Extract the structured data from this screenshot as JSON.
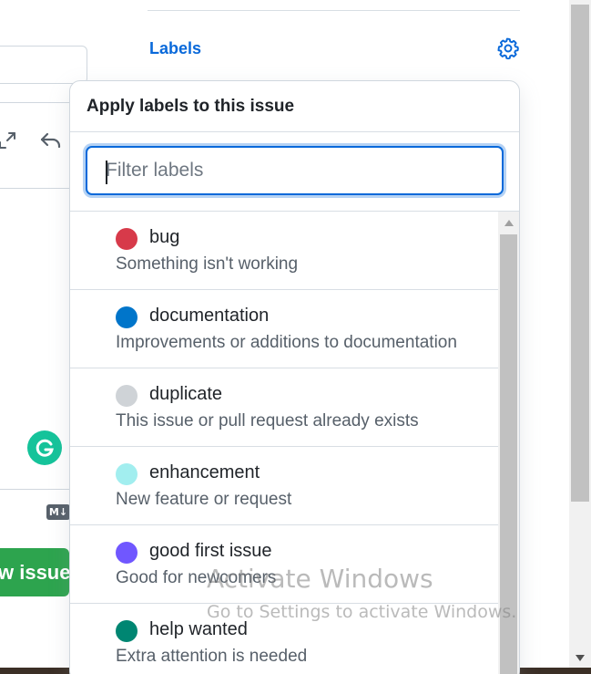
{
  "sidebar": {
    "labels_heading": "Labels"
  },
  "background": {
    "submit_button_label": "w issue",
    "markdown_badge": "M↓"
  },
  "popover": {
    "title": "Apply labels to this issue",
    "filter": {
      "placeholder": "Filter labels",
      "value": ""
    },
    "labels": [
      {
        "name": "bug",
        "description": "Something isn't working",
        "color": "#d73a4a"
      },
      {
        "name": "documentation",
        "description": "Improvements or additions to documentation",
        "color": "#0075ca"
      },
      {
        "name": "duplicate",
        "description": "This issue or pull request already exists",
        "color": "#cfd3d7"
      },
      {
        "name": "enhancement",
        "description": "New feature or request",
        "color": "#a2eeef"
      },
      {
        "name": "good first issue",
        "description": "Good for newcomers",
        "color": "#7057ff"
      },
      {
        "name": "help wanted",
        "description": "Extra attention is needed",
        "color": "#008672"
      }
    ]
  },
  "watermark": {
    "title": "Activate Windows",
    "subtitle": "Go to Settings to activate Windows."
  },
  "colors": {
    "accent": "#0969da",
    "submit_green": "#2da44e",
    "grammarly": "#15c39a"
  }
}
